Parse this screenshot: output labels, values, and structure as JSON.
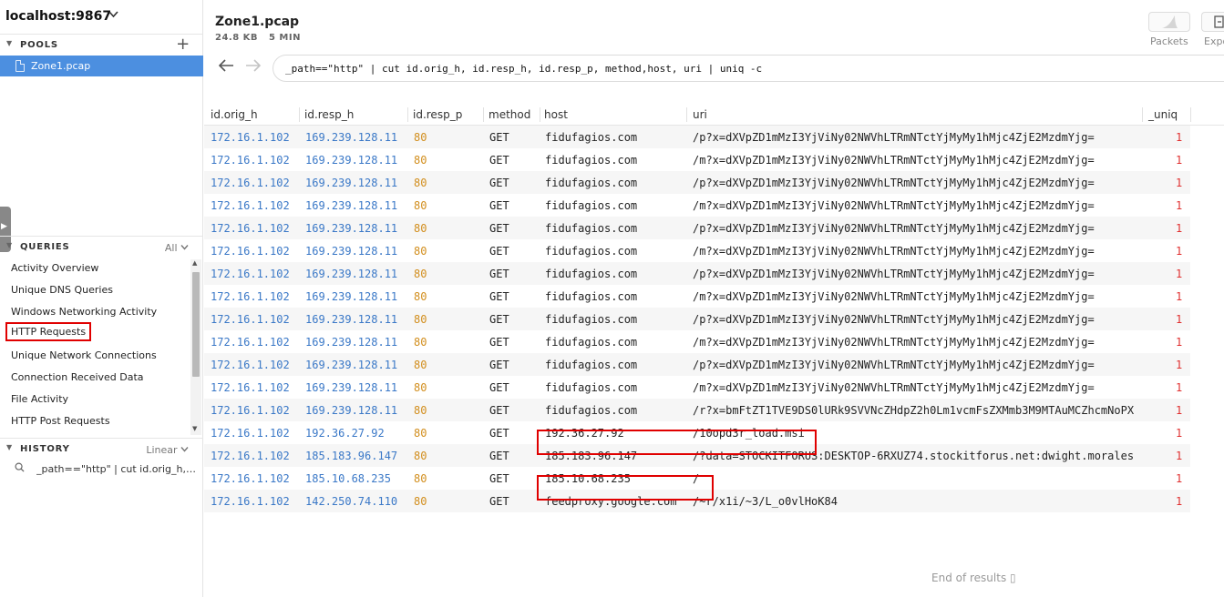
{
  "lake": {
    "name": "localhost:9867"
  },
  "pools": {
    "heading": "POOLS",
    "items": [
      {
        "label": "Zone1.pcap"
      }
    ]
  },
  "queries": {
    "heading": "QUERIES",
    "filter": "All",
    "items": [
      "Activity Overview",
      "Unique DNS Queries",
      "Windows Networking Activity",
      "HTTP Requests",
      "Unique Network Connections",
      "Connection Received Data",
      "File Activity",
      "HTTP Post Requests"
    ],
    "selected": "HTTP Requests"
  },
  "history": {
    "heading": "HISTORY",
    "mode": "Linear",
    "items": [
      "_path==\"http\" | cut id.orig_h, id.resp_h, id.resp_p, method,host, uri | uniq -c"
    ]
  },
  "header": {
    "title": "Zone1.pcap",
    "size": "24.8 KB",
    "duration": "5 MIN",
    "packets_label": "Packets",
    "export_label": "Export"
  },
  "search": {
    "query": "_path==\"http\" | cut id.orig_h, id.resp_h, id.resp_p, method,host, uri | uniq -c"
  },
  "table": {
    "columns": [
      "id.orig_h",
      "id.resp_h",
      "id.resp_p",
      "method",
      "host",
      "uri",
      "_uniq"
    ],
    "partial_row": [
      "172.16.1.102",
      "169.239.128.11",
      "80",
      "GET",
      "fidufagios.com",
      "/m?x=dXVpZD1mMzI3YjViNy02NWVhLTRmNTctYjMyMy1hMjc4ZjE2MzdmYjg=",
      "1"
    ],
    "rows": [
      [
        "172.16.1.102",
        "169.239.128.11",
        "80",
        "GET",
        "fidufagios.com",
        "/p?x=dXVpZD1mMzI3YjViNy02NWVhLTRmNTctYjMyMy1hMjc4ZjE2MzdmYjg=",
        "1"
      ],
      [
        "172.16.1.102",
        "169.239.128.11",
        "80",
        "GET",
        "fidufagios.com",
        "/m?x=dXVpZD1mMzI3YjViNy02NWVhLTRmNTctYjMyMy1hMjc4ZjE2MzdmYjg=",
        "1"
      ],
      [
        "172.16.1.102",
        "169.239.128.11",
        "80",
        "GET",
        "fidufagios.com",
        "/p?x=dXVpZD1mMzI3YjViNy02NWVhLTRmNTctYjMyMy1hMjc4ZjE2MzdmYjg=",
        "1"
      ],
      [
        "172.16.1.102",
        "169.239.128.11",
        "80",
        "GET",
        "fidufagios.com",
        "/m?x=dXVpZD1mMzI3YjViNy02NWVhLTRmNTctYjMyMy1hMjc4ZjE2MzdmYjg=",
        "1"
      ],
      [
        "172.16.1.102",
        "169.239.128.11",
        "80",
        "GET",
        "fidufagios.com",
        "/p?x=dXVpZD1mMzI3YjViNy02NWVhLTRmNTctYjMyMy1hMjc4ZjE2MzdmYjg=",
        "1"
      ],
      [
        "172.16.1.102",
        "169.239.128.11",
        "80",
        "GET",
        "fidufagios.com",
        "/m?x=dXVpZD1mMzI3YjViNy02NWVhLTRmNTctYjMyMy1hMjc4ZjE2MzdmYjg=",
        "1"
      ],
      [
        "172.16.1.102",
        "169.239.128.11",
        "80",
        "GET",
        "fidufagios.com",
        "/p?x=dXVpZD1mMzI3YjViNy02NWVhLTRmNTctYjMyMy1hMjc4ZjE2MzdmYjg=",
        "1"
      ],
      [
        "172.16.1.102",
        "169.239.128.11",
        "80",
        "GET",
        "fidufagios.com",
        "/m?x=dXVpZD1mMzI3YjViNy02NWVhLTRmNTctYjMyMy1hMjc4ZjE2MzdmYjg=",
        "1"
      ],
      [
        "172.16.1.102",
        "169.239.128.11",
        "80",
        "GET",
        "fidufagios.com",
        "/p?x=dXVpZD1mMzI3YjViNy02NWVhLTRmNTctYjMyMy1hMjc4ZjE2MzdmYjg=",
        "1"
      ],
      [
        "172.16.1.102",
        "169.239.128.11",
        "80",
        "GET",
        "fidufagios.com",
        "/m?x=dXVpZD1mMzI3YjViNy02NWVhLTRmNTctYjMyMy1hMjc4ZjE2MzdmYjg=",
        "1"
      ],
      [
        "172.16.1.102",
        "169.239.128.11",
        "80",
        "GET",
        "fidufagios.com",
        "/p?x=dXVpZD1mMzI3YjViNy02NWVhLTRmNTctYjMyMy1hMjc4ZjE2MzdmYjg=",
        "1"
      ],
      [
        "172.16.1.102",
        "169.239.128.11",
        "80",
        "GET",
        "fidufagios.com",
        "/m?x=dXVpZD1mMzI3YjViNy02NWVhLTRmNTctYjMyMy1hMjc4ZjE2MzdmYjg=",
        "1"
      ],
      [
        "172.16.1.102",
        "169.239.128.11",
        "80",
        "GET",
        "fidufagios.com",
        "/r?x=bmFtZT1TVE9DS0lURk9SVVNcZHdpZ2h0Lm1vcmFsZXMmb3M9MTAuMCZhcmNoPX",
        "1"
      ],
      [
        "172.16.1.102",
        "192.36.27.92",
        "80",
        "GET",
        "192.36.27.92",
        "/10opd3r_load.msi",
        "1"
      ],
      [
        "172.16.1.102",
        "185.183.96.147",
        "80",
        "GET",
        "185.183.96.147",
        "/?data=STOCKITFORUS:DESKTOP-6RXUZ74.stockitforus.net:dwight.morales",
        "1"
      ],
      [
        "172.16.1.102",
        "185.10.68.235",
        "80",
        "GET",
        "185.10.68.235",
        "/",
        "1"
      ],
      [
        "172.16.1.102",
        "142.250.74.110",
        "80",
        "GET",
        "feedproxy.google.com",
        "/~r/x1i/~3/L_o0vlHoK84",
        "1"
      ]
    ]
  },
  "footer": {
    "end_text": "End of results ▯"
  },
  "colors": {
    "accent": "#4c8fe0",
    "ip": "#3a78c7",
    "port": "#d28e1d",
    "uniq": "#e03030",
    "highlight": "#e00000"
  }
}
